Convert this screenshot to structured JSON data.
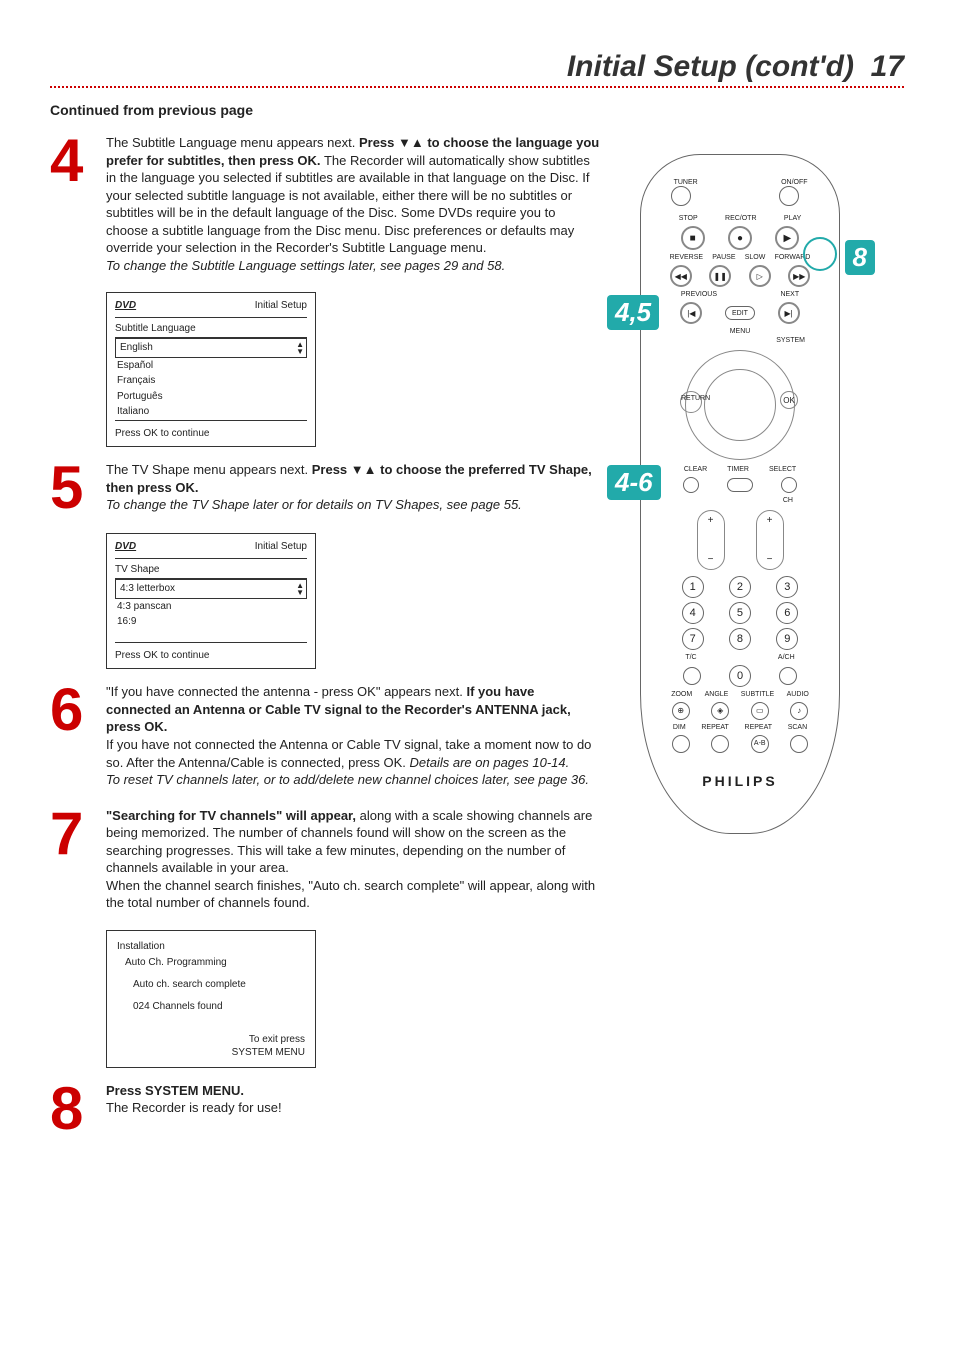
{
  "page": {
    "title_main": "Initial Setup (cont'd)",
    "title_pagenum": "17",
    "continued": "Continued from previous page"
  },
  "step4": {
    "num": "4",
    "p1a": "The Subtitle Language menu appears next. ",
    "p1b": "Press ▼▲ to choose the language you prefer for subtitles, then press OK.",
    "p2": "The Recorder will automatically show subtitles in the language you selected if subtitles are available in that language on the Disc. If your selected subtitle language is not available, either there will be no subtitles or subtitles will be in the default language of the Disc. Some DVDs require you to choose a subtitle language from the Disc menu. Disc preferences or defaults may override your selection in the Recorder's Subtitle Language menu.",
    "p3": "To change the Subtitle Language settings later, see pages 29 and 58.",
    "osd": {
      "logo": "DVD",
      "label": "Initial Setup",
      "heading": "Subtitle Language",
      "items": [
        "English",
        "Español",
        "Français",
        "Português",
        "Italiano"
      ],
      "footer": "Press OK to continue"
    }
  },
  "step5": {
    "num": "5",
    "p1a": "The TV Shape menu appears next. ",
    "p1b": "Press ▼▲ to choose the preferred TV Shape, then press OK.",
    "p2": "To change the TV Shape later or for details on TV Shapes, see page 55.",
    "osd": {
      "logo": "DVD",
      "label": "Initial Setup",
      "heading": "TV Shape",
      "items": [
        "4:3 letterbox",
        "4:3 panscan",
        "16:9"
      ],
      "footer": "Press OK to continue"
    }
  },
  "step6": {
    "num": "6",
    "p1a": "\"If you have connected the antenna - press OK\" appears next. ",
    "p1b": "If you have connected an Antenna or Cable TV signal to the Recorder's ANTENNA jack, press OK.",
    "p2": "If you have not connected the Antenna or Cable TV signal, take a moment now to do so. After the Antenna/Cable is connected, press OK. ",
    "p2i": "Details are on pages 10-14.",
    "p3": "To reset TV channels later, or to add/delete new channel choices later, see page 36."
  },
  "step7": {
    "num": "7",
    "p1a": "\"Searching for TV channels\" will appear, ",
    "p1b": "along with a scale showing channels are being memorized. The number of channels found will show on the screen as the searching progresses. This will take a few minutes, depending on the number of channels available in your area.",
    "p2": "When the channel search finishes, \"Auto ch. search complete\" will appear, along with the total number of channels found.",
    "osd": {
      "h1": "Installation",
      "h2": "Auto Ch. Programming",
      "line1": "Auto ch. search complete",
      "line2": "024 Channels found",
      "foot1": "To exit press",
      "foot2": "SYSTEM MENU"
    }
  },
  "step8": {
    "num": "8",
    "p1a": "Press SYSTEM MENU.",
    "p2": "The Recorder is ready for use!"
  },
  "remote": {
    "top_labels": {
      "tuner": "TUNER",
      "onoff": "ON/OFF"
    },
    "row2": {
      "stop": "STOP",
      "recotr": "REC/OTR",
      "play": "PLAY"
    },
    "row3": {
      "reverse": "REVERSE",
      "pause": "PAUSE",
      "slow": "SLOW",
      "forward": "FORWARD"
    },
    "row4": {
      "previous": "PREVIOUS",
      "edit": "EDIT",
      "next": "NEXT"
    },
    "menu": "MENU",
    "system": "SYSTEM",
    "return": "RETURN",
    "ok": "OK",
    "clear": "CLEAR",
    "timer": "TIMER",
    "select": "SELECT",
    "ch": "CH",
    "tc": "T/C",
    "a_ch": "A/CH",
    "bottom": {
      "zoom": "ZOOM",
      "angle": "ANGLE",
      "subtitle": "SUBTITLE",
      "audio": "AUDIO",
      "dim": "DIM",
      "repeat": "REPEAT",
      "repeat_ab": "REPEAT",
      "scan": "SCAN",
      "ab": "A-B"
    },
    "brand": "PHILIPS",
    "callouts": {
      "c8": "8",
      "c45": "4,5",
      "c46": "4-6"
    },
    "glyphs": {
      "stop": "■",
      "rec": "●",
      "play": "▶",
      "rev": "◀◀",
      "pause": "❚❚",
      "slow": "▷",
      "fwd": "▶▶",
      "prev": "|◀",
      "next": "▶|",
      "plus": "+",
      "minus": "−",
      "zoom": "⊕",
      "angle": "◈",
      "subtitle": "▭",
      "audio": "♪"
    }
  }
}
